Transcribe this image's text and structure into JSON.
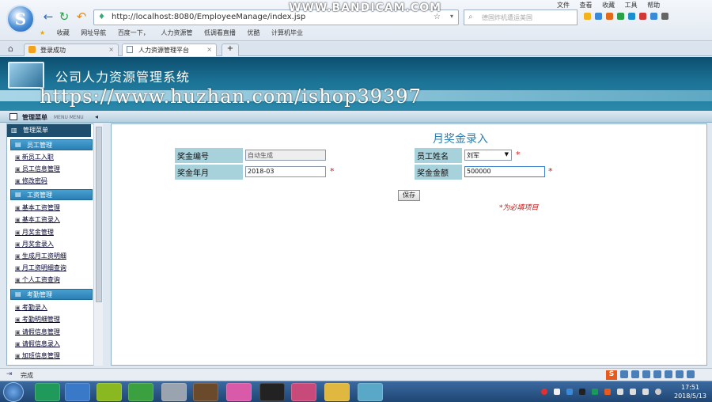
{
  "browser": {
    "url": "http://localhost:8080/EmployeeManage/index.jsp",
    "search_placeholder": "德国炸机遭运美国",
    "menu": [
      "文件",
      "查看",
      "收藏",
      "工具",
      "帮助"
    ],
    "bookmarks": [
      "收藏",
      "网址导航",
      "百度一下，",
      "人力资源管",
      "低调看直播",
      "优酷",
      "计算机毕业"
    ],
    "tabs": [
      {
        "label": "登录成功",
        "active": false
      },
      {
        "label": "人力资源管理平台",
        "active": true
      }
    ]
  },
  "overlay": {
    "bandicam": "WWW.BANDICAM.COM",
    "watermark": "https://www.huzhan.com/ishop39397"
  },
  "app": {
    "title": "公司人力资源管理系统",
    "menu_bar_label": "管理菜单",
    "menu_bar_sub": "MENU MENU"
  },
  "sidebar": {
    "top_label": "管理菜单",
    "groups": [
      {
        "label": "员工管理",
        "items": [
          "新员工入职",
          "员工信息管理",
          "修改密码"
        ]
      },
      {
        "label": "工资管理",
        "items": [
          "基本工资管理",
          "基本工资录入",
          "月奖金管理",
          "月奖金录入",
          "生成月工资明细",
          "月工资明细查询",
          "个人工资查询"
        ]
      },
      {
        "label": "考勤管理",
        "items": [
          "考勤录入",
          "考勤明细管理",
          "请假信息管理",
          "请假信息录入",
          "加班信息管理"
        ]
      }
    ]
  },
  "form": {
    "title": "月奖金录入",
    "fields": {
      "bonus_no": {
        "label": "奖金编号",
        "value": "自动生成"
      },
      "bonus_month": {
        "label": "奖金年月",
        "value": "2018-03"
      },
      "employee_name": {
        "label": "员工姓名",
        "value": "刘军"
      },
      "bonus_amount": {
        "label": "奖金金额",
        "value": "500000"
      }
    },
    "required_star": "*",
    "save_label": "保存",
    "required_note": "*为必填项目"
  },
  "status": {
    "text": "完成"
  },
  "taskbar": {
    "time": "17:51",
    "date": "2018/5/13"
  },
  "colors": {
    "header": "#1b7295",
    "group": "#2a7fb4",
    "label_bg": "#a7d2dc",
    "required": "#d01818"
  }
}
